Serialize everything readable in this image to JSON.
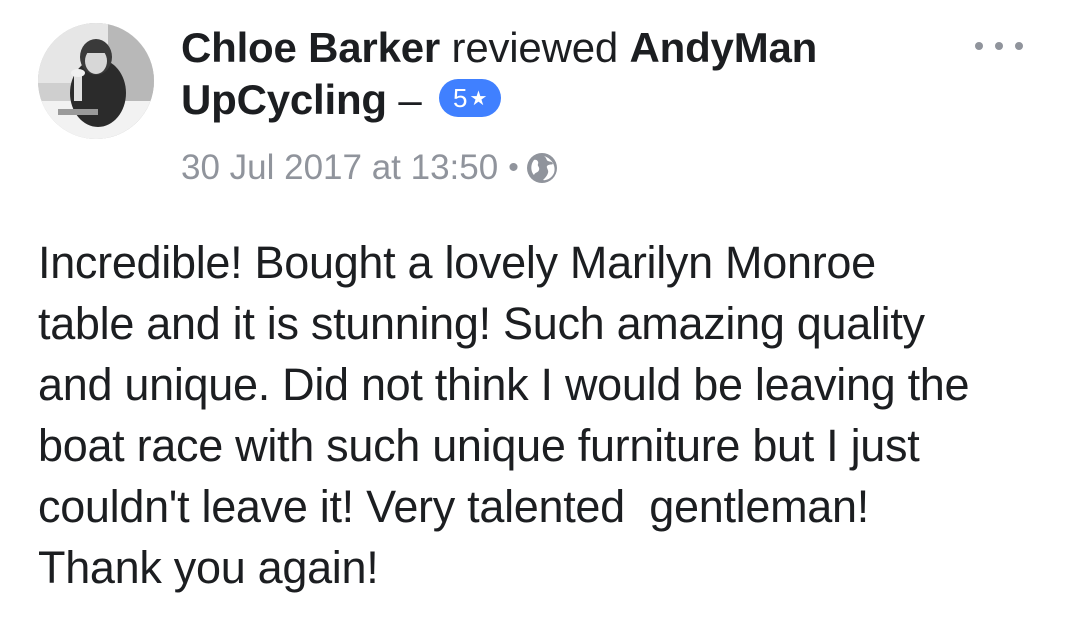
{
  "post": {
    "reviewer_name": "Chloe Barker",
    "action_text": "reviewed",
    "page_name": "AndyMan UpCycling",
    "separator": "–",
    "rating": {
      "value": "5",
      "star_glyph": "★",
      "color": "#4080ff"
    },
    "timestamp": "30 Jul 2017 at 13:50",
    "meta_dot": "•",
    "privacy_icon": "globe-icon",
    "menu_icon": "more-options-icon",
    "review_text": "Incredible! Bought a lovely Marilyn Monroe\ntable and it is stunning! Such amazing quality\nand unique. Did not think I would be leaving the\nboat race with such unique furniture but I just\ncouldn't leave it! Very talented  gentleman!\nThank you again!"
  },
  "colors": {
    "text_primary": "#1c1e21",
    "text_secondary": "#90949c",
    "badge_blue": "#4080ff"
  }
}
